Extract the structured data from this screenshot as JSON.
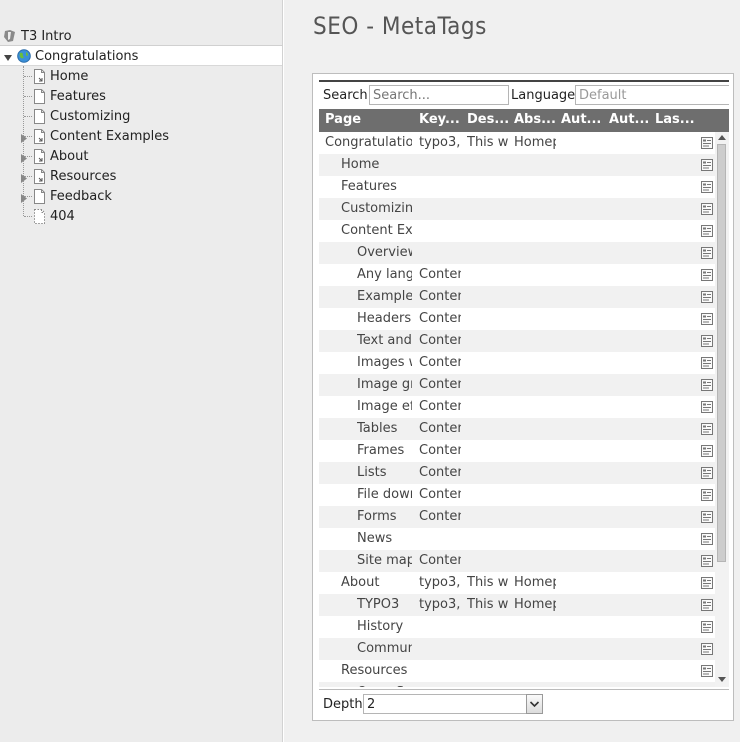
{
  "tree": {
    "root": "T3 Intro",
    "items": [
      {
        "label": "Congratulations",
        "icon": "globe-icon",
        "expander": "expanded",
        "depth": 0
      },
      {
        "label": "Home",
        "icon": "page-shortcut-icon",
        "expander": "",
        "depth": 1
      },
      {
        "label": "Features",
        "icon": "page-icon",
        "expander": "",
        "depth": 1
      },
      {
        "label": "Customizing",
        "icon": "page-icon",
        "expander": "",
        "depth": 1
      },
      {
        "label": "Content Examples",
        "icon": "page-shortcut-icon",
        "expander": "collapsed",
        "depth": 1
      },
      {
        "label": "About",
        "icon": "page-shortcut-icon",
        "expander": "collapsed",
        "depth": 1
      },
      {
        "label": "Resources",
        "icon": "page-shortcut-icon",
        "expander": "collapsed",
        "depth": 1
      },
      {
        "label": "Feedback",
        "icon": "page-icon",
        "expander": "collapsed",
        "depth": 1
      },
      {
        "label": "404",
        "icon": "page-hidden-icon",
        "expander": "",
        "depth": 1
      }
    ]
  },
  "module": {
    "title": "SEO - MetaTags",
    "search_label": "Search",
    "search_placeholder": "Search...",
    "language_label": "Language",
    "language_value": "Default",
    "columns": [
      "Page",
      "Key...",
      "Des...",
      "Abs...",
      "Aut...",
      "Aut...",
      "Las..."
    ],
    "rows": [
      {
        "page": "Congratulations",
        "indent": 0,
        "keywords": "typo3,",
        "description": "This w",
        "abstract": "Homep"
      },
      {
        "page": "Home",
        "indent": 1,
        "keywords": "",
        "description": "",
        "abstract": ""
      },
      {
        "page": "Features",
        "indent": 1,
        "keywords": "",
        "description": "",
        "abstract": ""
      },
      {
        "page": "Customizing",
        "indent": 1,
        "keywords": "",
        "description": "",
        "abstract": ""
      },
      {
        "page": "Content Examples",
        "indent": 1,
        "keywords": "",
        "description": "",
        "abstract": ""
      },
      {
        "page": "Overview",
        "indent": 2,
        "keywords": "",
        "description": "",
        "abstract": ""
      },
      {
        "page": "Any language",
        "indent": 2,
        "keywords": "Content",
        "description": "",
        "abstract": ""
      },
      {
        "page": "Examples",
        "indent": 2,
        "keywords": "Content",
        "description": "",
        "abstract": ""
      },
      {
        "page": "Headers",
        "indent": 2,
        "keywords": "Content",
        "description": "",
        "abstract": ""
      },
      {
        "page": "Text and images",
        "indent": 2,
        "keywords": "Content",
        "description": "",
        "abstract": ""
      },
      {
        "page": "Images with text",
        "indent": 2,
        "keywords": "Content",
        "description": "",
        "abstract": ""
      },
      {
        "page": "Image groups",
        "indent": 2,
        "keywords": "Content",
        "description": "",
        "abstract": ""
      },
      {
        "page": "Image effects",
        "indent": 2,
        "keywords": "Content",
        "description": "",
        "abstract": ""
      },
      {
        "page": "Tables",
        "indent": 2,
        "keywords": "Content",
        "description": "",
        "abstract": ""
      },
      {
        "page": "Frames",
        "indent": 2,
        "keywords": "Content",
        "description": "",
        "abstract": ""
      },
      {
        "page": "Lists",
        "indent": 2,
        "keywords": "Content",
        "description": "",
        "abstract": ""
      },
      {
        "page": "File downloads",
        "indent": 2,
        "keywords": "Content",
        "description": "",
        "abstract": ""
      },
      {
        "page": "Forms",
        "indent": 2,
        "keywords": "Content",
        "description": "",
        "abstract": ""
      },
      {
        "page": "News",
        "indent": 2,
        "keywords": "",
        "description": "",
        "abstract": ""
      },
      {
        "page": "Site map",
        "indent": 2,
        "keywords": "Content",
        "description": "",
        "abstract": ""
      },
      {
        "page": "About",
        "indent": 1,
        "keywords": "typo3,",
        "description": "This w",
        "abstract": "Homep"
      },
      {
        "page": "TYPO3",
        "indent": 2,
        "keywords": "typo3,",
        "description": "This w",
        "abstract": "Homep"
      },
      {
        "page": "History",
        "indent": 2,
        "keywords": "",
        "description": "",
        "abstract": ""
      },
      {
        "page": "Community",
        "indent": 2,
        "keywords": "",
        "description": "",
        "abstract": ""
      },
      {
        "page": "Resources",
        "indent": 1,
        "keywords": "",
        "description": "",
        "abstract": ""
      },
      {
        "page": "Open Source",
        "indent": 2,
        "keywords": "",
        "description": "",
        "abstract": ""
      }
    ],
    "depth_label": "Depth",
    "depth_value": "2"
  }
}
